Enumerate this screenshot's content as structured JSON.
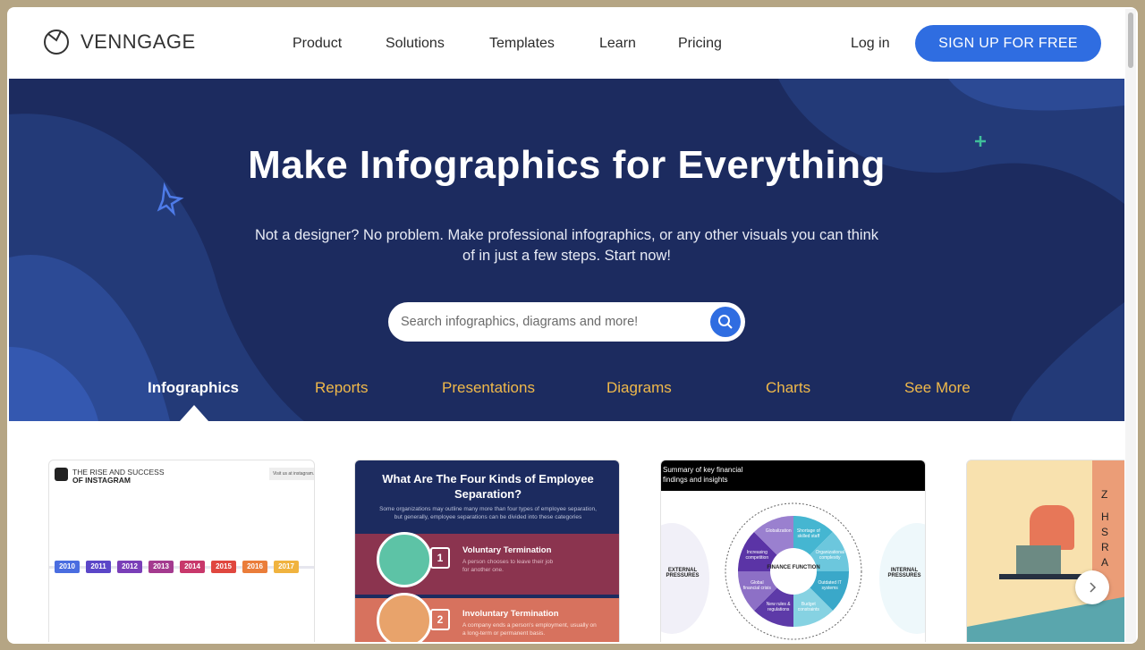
{
  "header": {
    "logo": "VENNGAGE",
    "nav": [
      "Product",
      "Solutions",
      "Templates",
      "Learn",
      "Pricing"
    ],
    "login": "Log in",
    "signup": "SIGN UP FOR FREE"
  },
  "hero": {
    "title": "Make Infographics for Everything",
    "subtitle": "Not a designer? No problem. Make professional infographics, or any other visuals you can think of in just a few steps. Start now!",
    "search_placeholder": "Search infographics, diagrams and more!"
  },
  "tabs": [
    {
      "label": "Infographics",
      "active": true
    },
    {
      "label": "Reports"
    },
    {
      "label": "Presentations"
    },
    {
      "label": "Diagrams"
    },
    {
      "label": "Charts"
    },
    {
      "label": "See More"
    }
  ],
  "colors": {
    "navy": "#1c2b5f",
    "accent": "#2f6de1",
    "tab": "#f0b94a"
  },
  "cards": [
    {
      "title_line1": "THE RISE AND SUCCESS",
      "title_line2": "OF INSTAGRAM",
      "link": "Visit us at instagram.com",
      "years": [
        "2010",
        "2011",
        "2012",
        "2013",
        "2014",
        "2015",
        "2016",
        "2017"
      ]
    },
    {
      "title": "What Are The Four Kinds of Employee Separation?",
      "intro": "Some organizations may outline many more than four types of employee separation, but generally, employee separations can be divided into these categories",
      "items": [
        {
          "num": "1",
          "title": "Voluntary Termination",
          "text": "A person chooses to leave their job for another one."
        },
        {
          "num": "2",
          "title": "Involuntary Termination",
          "text": "A company ends a person's employment, usually on a long-term or permanent basis."
        }
      ]
    },
    {
      "title": "Summary of key financial findings and insights",
      "center": "FINANCE FUNCTION",
      "left": "EXTERNAL PRESSURES",
      "right": "INTERNAL PRESSURES",
      "segments": [
        "Globalization",
        "Shortage of skilled staff",
        "Organizational complexity",
        "Outdated IT systems",
        "Budget constraints",
        "New rules & regulations",
        "Global financial crisis",
        "Increasing competition"
      ]
    },
    {
      "letters": [
        "Z",
        "H",
        "S",
        "R",
        "A"
      ]
    }
  ],
  "icons": {
    "search": "search-icon",
    "next": "chevron-right-icon",
    "logo": "venngage-logo-icon"
  }
}
